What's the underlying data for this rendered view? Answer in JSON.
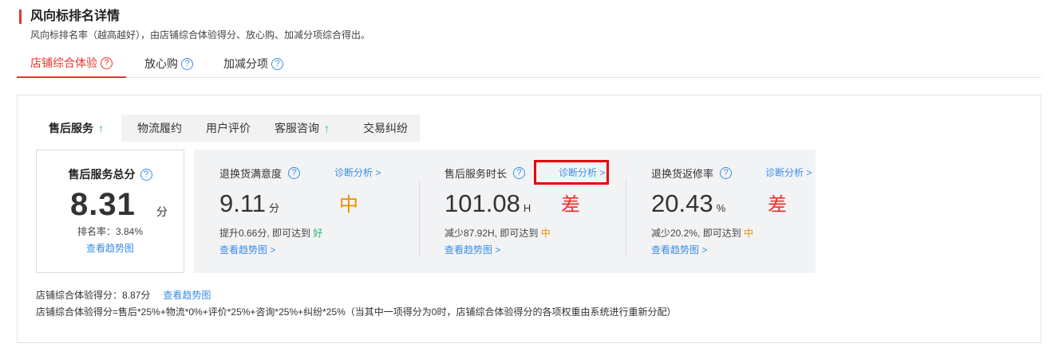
{
  "header": {
    "title": "风向标排名详情",
    "subtitle": "风向标排名率（越高越好），由店铺综合体验得分、放心购、加减分项综合得出。"
  },
  "top_tabs": [
    {
      "label": "店铺综合体验",
      "active": true
    },
    {
      "label": "放心购",
      "active": false
    },
    {
      "label": "加减分项",
      "active": false
    }
  ],
  "sub_tabs": [
    {
      "label": "售后服务",
      "active": true,
      "trend": "↑"
    },
    {
      "label": "物流履约",
      "active": false
    },
    {
      "label": "用户评价",
      "active": false
    },
    {
      "label": "客服咨询",
      "active": false,
      "trend": "↑"
    },
    {
      "label": "交易纠纷",
      "active": false
    }
  ],
  "total": {
    "label": "售后服务总分",
    "score": "8.31",
    "unit": "分",
    "rank": "排名率：3.84%",
    "trend_link": "查看趋势图"
  },
  "metrics": [
    {
      "name": "退换货满意度",
      "diag_link": "诊断分析 >",
      "value": "9.11",
      "unit": "分",
      "grade": "中",
      "tip_prefix": "提升0.66分, 即可达到",
      "tip_grade": "好",
      "trend_link": "查看趋势图 >"
    },
    {
      "name": "售后服务时长",
      "diag_link": "诊断分析 >",
      "value": "101.08",
      "unit": "H",
      "grade": "差",
      "tip_prefix": "减少87.92H, 即可达到",
      "tip_grade": "中",
      "trend_link": "查看趋势图 >"
    },
    {
      "name": "退换货返修率",
      "diag_link": "诊断分析 >",
      "value": "20.43",
      "unit": "%",
      "grade": "差",
      "tip_prefix": "减少20.2%, 即可达到",
      "tip_grade": "中",
      "trend_link": "查看趋势图 >"
    }
  ],
  "footer": {
    "score_text": "店铺综合体验得分：8.87分",
    "trend_link": "查看趋势图",
    "formula": "店铺综合体验得分=售后*25%+物流*0%+评价*25%+咨询*25%+纠纷*25%（当其中一项得分为0时，店铺综合体验得分的各项权重由系统进行重新分配）"
  },
  "icons": {
    "help": "?"
  },
  "colors": {
    "accent_red": "#e8342b",
    "link_blue": "#3a8ee6",
    "grade_mid": "#f08c00",
    "grade_good": "#2bb673",
    "trend_up": "#2bb673"
  }
}
